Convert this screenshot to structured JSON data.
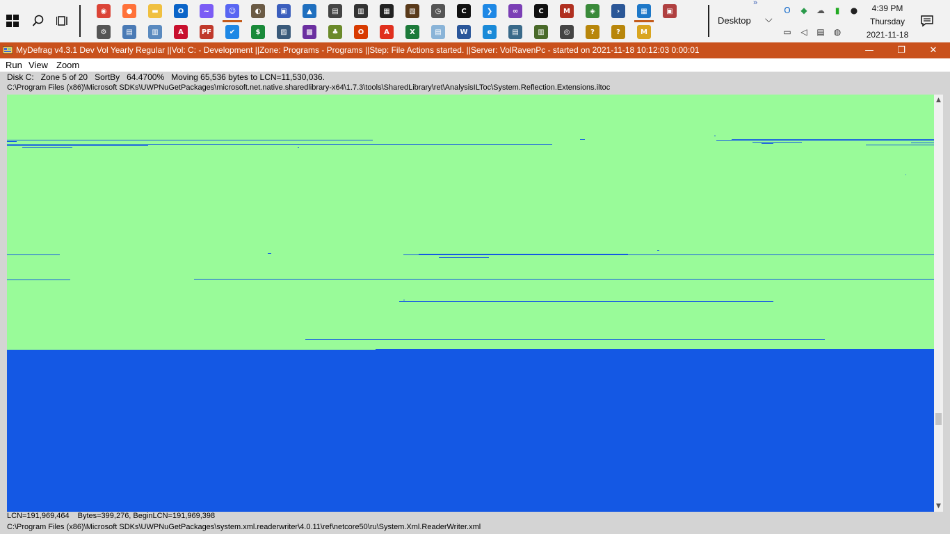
{
  "taskbar": {
    "desktop_label": "Desktop",
    "more_label": "»",
    "clock": {
      "time": "4:39 PM",
      "day": "Thursday",
      "date": "2021-11-18"
    },
    "pinned_row1": [
      {
        "name": "chrome-icon",
        "color": "#db4437",
        "glyph": "◉",
        "running": true
      },
      {
        "name": "firefox-icon",
        "color": "#ff7139",
        "glyph": "●",
        "running": true
      },
      {
        "name": "file-explorer-icon",
        "color": "#f0c040",
        "glyph": "▬",
        "running": true
      },
      {
        "name": "outlook-icon",
        "color": "#0a64c8",
        "glyph": "O",
        "running": true
      },
      {
        "name": "messenger-icon",
        "color": "#7b5cf5",
        "glyph": "~",
        "running": false
      },
      {
        "name": "discord-icon",
        "color": "#5865f2",
        "glyph": "☺",
        "running": false
      },
      {
        "name": "gimp-icon",
        "color": "#6b5b45",
        "glyph": "◐",
        "running": false
      },
      {
        "name": "paint-icon",
        "color": "#3b5ebd",
        "glyph": "▣",
        "running": false
      },
      {
        "name": "photos-icon",
        "color": "#1f6fbf",
        "glyph": "▲",
        "running": false
      },
      {
        "name": "printer-icon",
        "color": "#444444",
        "glyph": "▤",
        "running": false
      },
      {
        "name": "camera-icon",
        "color": "#333333",
        "glyph": "▥",
        "running": false
      },
      {
        "name": "scanner-icon",
        "color": "#222222",
        "glyph": "▦",
        "running": false
      },
      {
        "name": "notes-icon",
        "color": "#5a3a1a",
        "glyph": "▧",
        "running": false
      },
      {
        "name": "clock-app-icon",
        "color": "#555555",
        "glyph": "◷",
        "running": false
      },
      {
        "name": "terminal-icon",
        "color": "#111111",
        "glyph": "C",
        "running": true
      },
      {
        "name": "vscode-icon",
        "color": "#1e88e5",
        "glyph": "❯",
        "running": false
      },
      {
        "name": "visual-studio-icon",
        "color": "#7b3fb5",
        "glyph": "∞",
        "running": true
      },
      {
        "name": "cmd-icon",
        "color": "#111111",
        "glyph": "C",
        "running": false
      },
      {
        "name": "mydefrag-icon",
        "color": "#b03020",
        "glyph": "M",
        "running": true
      },
      {
        "name": "control-panel-icon",
        "color": "#3a8a3a",
        "glyph": "◈",
        "running": false
      },
      {
        "name": "powershell-icon",
        "color": "#2b5797",
        "glyph": "›",
        "running": false
      },
      {
        "name": "settings-grid-icon",
        "color": "#1e78c8",
        "glyph": "▦",
        "running": false
      },
      {
        "name": "remote-icon",
        "color": "#b04040",
        "glyph": "▣",
        "running": false
      }
    ],
    "pinned_row2": [
      {
        "name": "gear-icon",
        "color": "#555555",
        "glyph": "⚙",
        "running": false
      },
      {
        "name": "network-icon",
        "color": "#4a7ab5",
        "glyph": "▤",
        "running": false
      },
      {
        "name": "system-info-icon",
        "color": "#5a8abf",
        "glyph": "▥",
        "running": false
      },
      {
        "name": "amd-icon",
        "color": "#c8102e",
        "glyph": "A",
        "running": false
      },
      {
        "name": "pdf-factory-icon",
        "color": "#c0392b",
        "glyph": "PF",
        "running": false
      },
      {
        "name": "todo-icon",
        "color": "#1e88e5",
        "glyph": "✔",
        "running": true
      },
      {
        "name": "money-icon",
        "color": "#1a8a3a",
        "glyph": "$",
        "running": false
      },
      {
        "name": "image-viewer-icon",
        "color": "#3a5a7a",
        "glyph": "▨",
        "running": false
      },
      {
        "name": "media-icon",
        "color": "#6b2fa0",
        "glyph": "▩",
        "running": false
      },
      {
        "name": "tree-icon",
        "color": "#6b8a2a",
        "glyph": "♣",
        "running": false
      },
      {
        "name": "office-icon",
        "color": "#d83b01",
        "glyph": "O",
        "running": false
      },
      {
        "name": "acrobat-icon",
        "color": "#e0301e",
        "glyph": "A",
        "running": false
      },
      {
        "name": "excel-icon",
        "color": "#1d7a3a",
        "glyph": "X",
        "running": false
      },
      {
        "name": "notepad-icon",
        "color": "#8ab4d8",
        "glyph": "▤",
        "running": false
      },
      {
        "name": "word-icon",
        "color": "#2b579a",
        "glyph": "W",
        "running": false
      },
      {
        "name": "edge-icon",
        "color": "#1a8ad8",
        "glyph": "e",
        "running": false
      },
      {
        "name": "task-manager-icon",
        "color": "#3a6a8a",
        "glyph": "▤",
        "running": false
      },
      {
        "name": "spreadsheet-tool-icon",
        "color": "#4a6a2a",
        "glyph": "▥",
        "running": false
      },
      {
        "name": "snapshot-icon",
        "color": "#444444",
        "glyph": "◎",
        "running": false
      },
      {
        "name": "help-tool-icon",
        "color": "#b8860b",
        "glyph": "?",
        "running": false
      },
      {
        "name": "help-tool-2-icon",
        "color": "#b8860b",
        "glyph": "?",
        "running": false
      },
      {
        "name": "mydefrag-small-icon",
        "color": "#d9a520",
        "glyph": "M",
        "running": true
      }
    ],
    "tray": [
      {
        "name": "outlook-tray-icon",
        "glyph": "O",
        "color": "#0a64c8"
      },
      {
        "name": "shield-tray-icon",
        "glyph": "◆",
        "color": "#2a9a4a"
      },
      {
        "name": "onedrive-icon",
        "glyph": "☁",
        "color": "#555555"
      },
      {
        "name": "battery-icon",
        "glyph": "▮",
        "color": "#22aa22"
      },
      {
        "name": "microphone-icon",
        "glyph": "●",
        "color": "#222222"
      },
      {
        "name": "display-network-icon",
        "glyph": "▭",
        "color": "#222222"
      },
      {
        "name": "volume-icon",
        "glyph": "◁",
        "color": "#222222"
      },
      {
        "name": "clipboard-tray-icon",
        "glyph": "▤",
        "color": "#333333"
      },
      {
        "name": "webcam-tray-icon",
        "glyph": "◍",
        "color": "#333333"
      }
    ]
  },
  "window": {
    "title": "MyDefrag v4.3.1    Dev Vol Yearly Regular ||Vol: C: - Development ||Zone: Programs - Programs ||Step: File Actions started. ||Server: VolRavenPc -  started on 2021-11-18 10:12:03 0:00:01",
    "controls": {
      "minimize": "—",
      "restore": "❐",
      "close": "✕"
    },
    "brand_color": "#c9511c"
  },
  "menu": [
    "Run",
    "View",
    "Zoom"
  ],
  "status": {
    "disk": "Disk C:",
    "zone": "Zone 5 of 20",
    "sortby": "SortBy",
    "percent": "64.4700%",
    "moving": "Moving 65,536 bytes to LCN=11,530,036.",
    "current_path": "C:\\Program Files (x86)\\Microsoft SDKs\\UWPNuGetPackages\\microsoft.net.native.sharedlibrary-x64\\1.7.3\\tools\\SharedLibrary\\ret\\AnalysisILToc\\System.Reflection.Extensions.iltoc"
  },
  "bottom_status": {
    "lcn": "LCN=191,969,464",
    "bytes": "Bytes=399,276, BeginLCN=191,969,398",
    "file_path": "C:\\Program Files (x86)\\Microsoft SDKs\\UWPNuGetPackages\\system.xml.readerwriter\\4.0.11\\ref\\netcore50\\ru\\System.Xml.ReaderWriter.xml"
  },
  "diskmap": {
    "colors": {
      "free": "#99fb99",
      "used": "#1458e4",
      "fragment_line": "#1458e4"
    }
  }
}
